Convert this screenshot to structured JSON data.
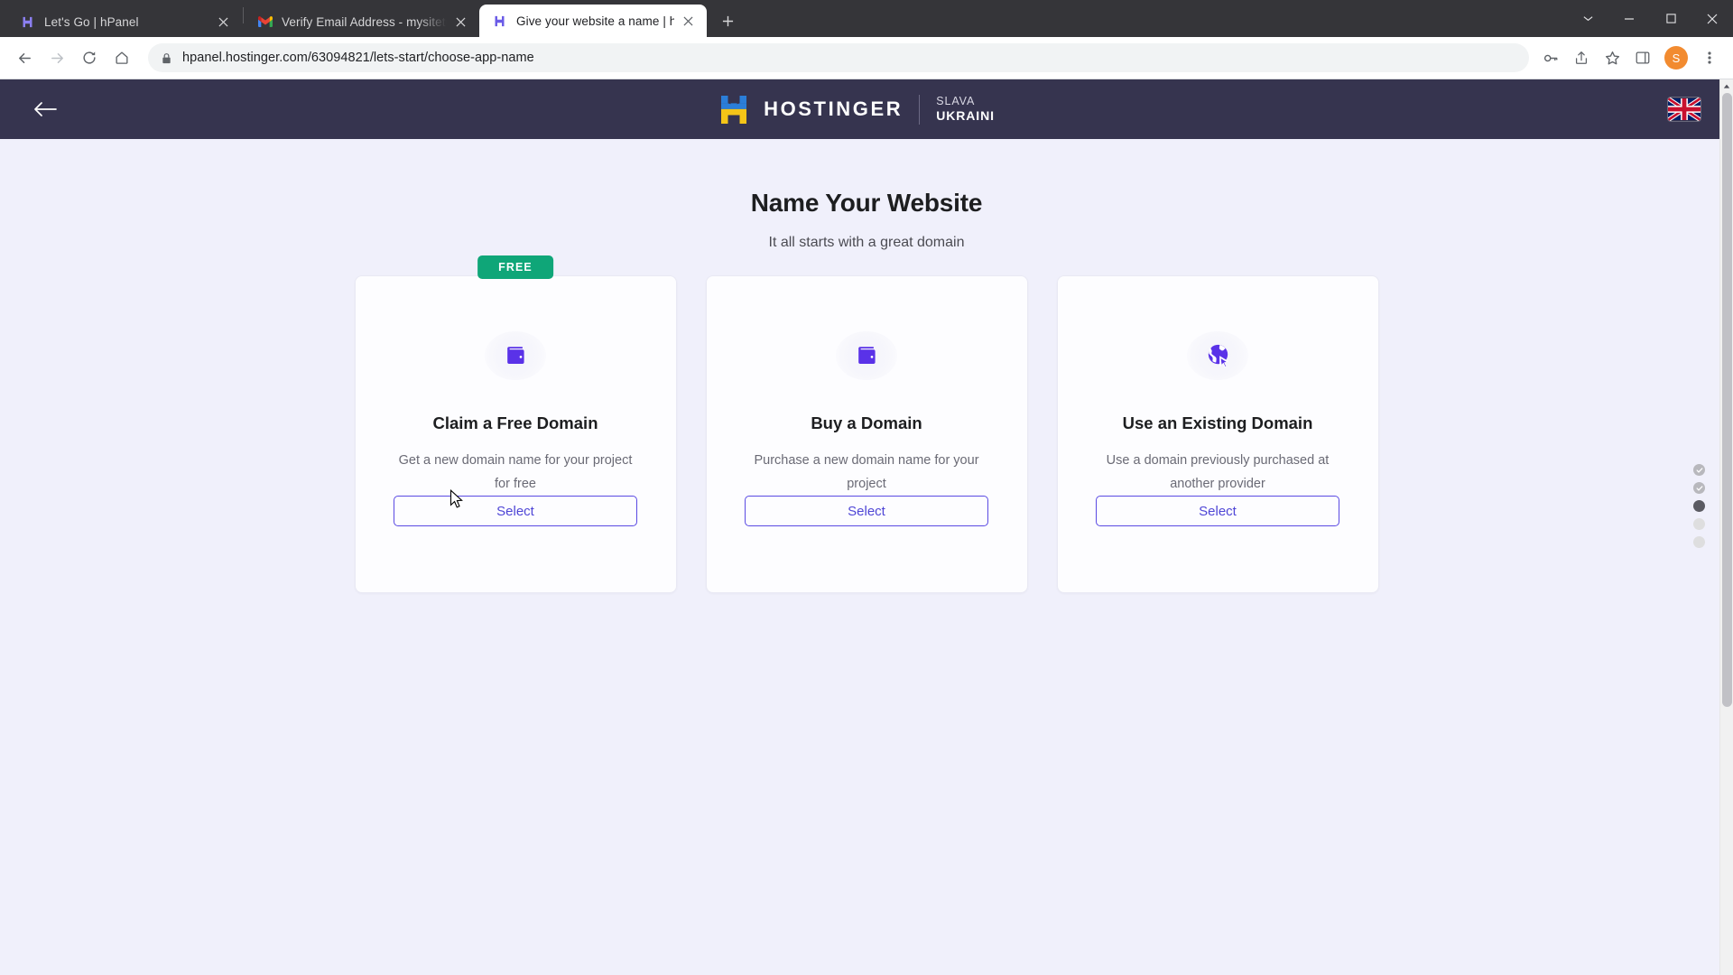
{
  "browser": {
    "tabs": [
      {
        "title": "Let's Go | hPanel",
        "favicon": "hostinger-icon",
        "active": false
      },
      {
        "title": "Verify Email Address - mysitetuto",
        "favicon": "gmail-icon",
        "active": false
      },
      {
        "title": "Give your website a name | hPane",
        "favicon": "hostinger-icon",
        "active": true
      }
    ],
    "new_tab_label": "+",
    "window_controls": {
      "minimize_all": "chevron-down",
      "minimize": "minimize",
      "maximize": "maximize",
      "close": "close"
    },
    "toolbar": {
      "back": "back-arrow",
      "forward": "forward-arrow",
      "reload": "reload",
      "home": "home",
      "url": "hpanel.hostinger.com/63094821/lets-start/choose-app-name",
      "security": "lock-icon",
      "password_manager": "key-icon",
      "share": "share-icon",
      "bookmark": "star-icon",
      "side_panel": "side-panel-icon",
      "profile_initial": "S",
      "menu": "three-dot-menu-icon"
    }
  },
  "header": {
    "back_label": "back-arrow",
    "brand": "HOSTINGER",
    "slogan_line1": "SLAVA",
    "slogan_line2": "UKRAINI",
    "language_flag": "united-kingdom-flag",
    "bg_color": "#36344f"
  },
  "main": {
    "title": "Name Your Website",
    "subtitle": "It all starts with a great domain",
    "cards": [
      {
        "badge": "FREE",
        "icon": "wallet-icon",
        "title": "Claim a Free Domain",
        "description": "Get a new domain name for your project for free",
        "button": "Select"
      },
      {
        "badge": "",
        "icon": "wallet-icon",
        "title": "Buy a Domain",
        "description": "Purchase a new domain name for your project",
        "button": "Select"
      },
      {
        "badge": "",
        "icon": "globe-cursor-icon",
        "title": "Use an Existing Domain",
        "description": "Use a domain previously purchased at another provider",
        "button": "Select"
      }
    ],
    "progress_steps": [
      {
        "state": "done"
      },
      {
        "state": "done"
      },
      {
        "state": "current"
      },
      {
        "state": "pending"
      },
      {
        "state": "pending"
      }
    ]
  },
  "colors": {
    "accent_purple": "#5a4ae3",
    "badge_green": "#0fa678",
    "header_bg": "#36344f",
    "page_bg": "#f0f0fb"
  }
}
